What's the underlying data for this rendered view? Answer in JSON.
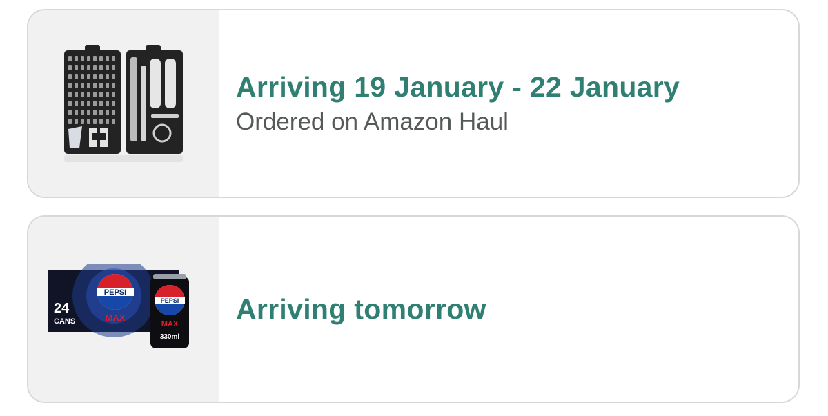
{
  "orders": [
    {
      "product_image": "precision-screwdriver-set-image",
      "status": "Arriving 19 January - 22 January",
      "detail": "Ordered on Amazon Haul"
    },
    {
      "product_image": "pepsi-max-24-cans-image",
      "status": "Arriving tomorrow",
      "image_text": {
        "count": "24",
        "count_unit": "CANS",
        "brand": "PEPSI",
        "variant": "MAX",
        "volume": "330ml"
      }
    }
  ],
  "colors": {
    "status_text": "#2f7f73",
    "detail_text": "#565959",
    "card_border": "#d5d9d9",
    "thumb_background": "#f1f1f1"
  }
}
